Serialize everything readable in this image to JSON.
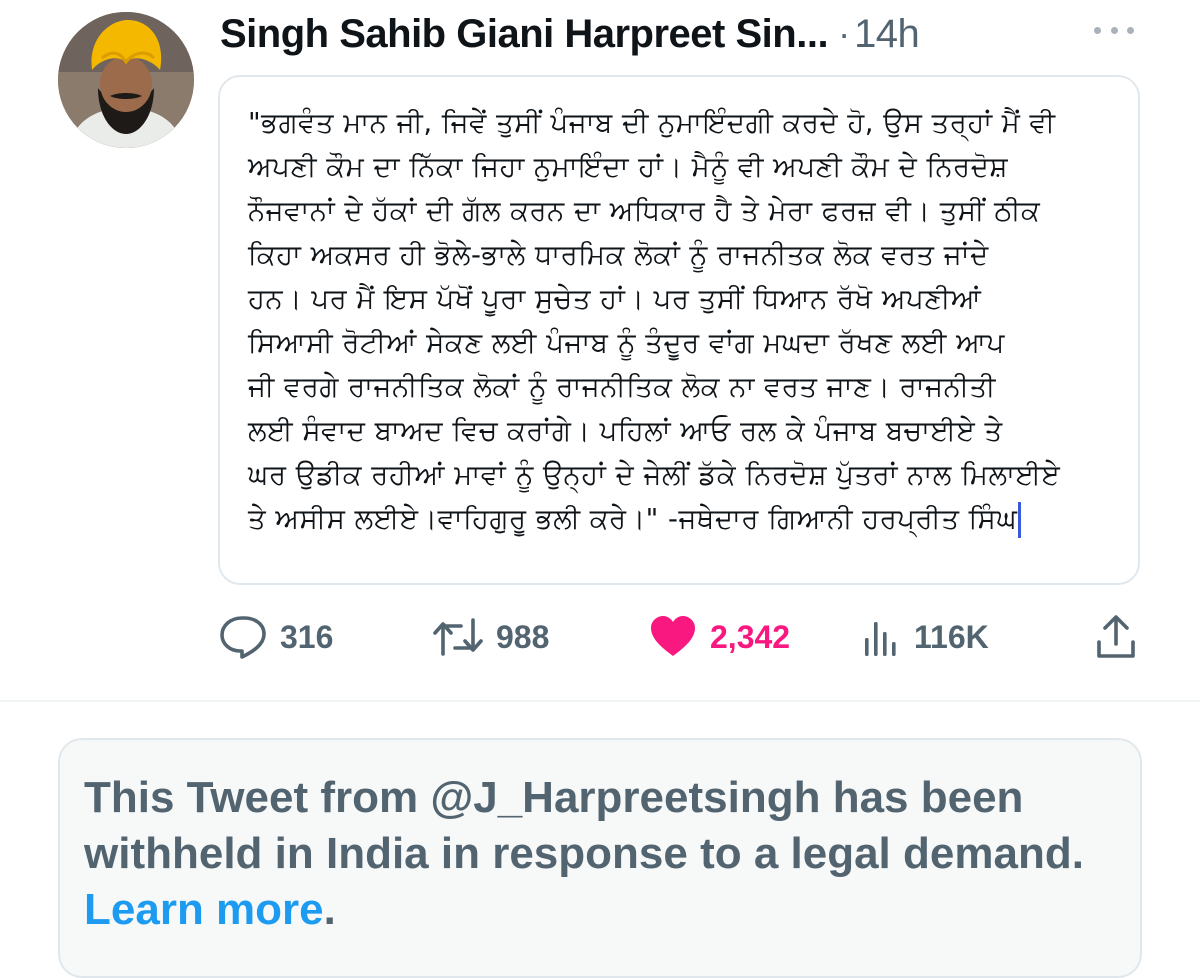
{
  "tweet": {
    "author_name": "Singh Sahib Giani Harpreet Sin...",
    "separator": "·",
    "time": "14h",
    "lines": [
      "\"ਭਗਵੰਤ ਮਾਨ ਜੀ, ਜਿਵੇਂ ਤੁਸੀਂ ਪੰਜਾਬ ਦੀ ਨੁਮਾਇੰਦਗੀ ਕਰਦੇ ਹੋ, ਉਸ ਤਰ੍ਹਾਂ ਮੈਂ ਵੀ",
      "ਅਪਣੀ ਕੌਮ ਦਾ ਨਿੱਕਾ ਜਿਹਾ ਨੁਮਾਇੰਦਾ ਹਾਂ। ਮੈਨੂੰ ਵੀ ਅਪਣੀ ਕੌਮ ਦੇ ਨਿਰਦੋਸ਼",
      "ਨੌਜਵਾਨਾਂ ਦੇ ਹੱਕਾਂ ਦੀ ਗੱਲ ਕਰਨ ਦਾ ਅਧਿਕਾਰ ਹੈ ਤੇ ਮੇਰਾ ਫਰਜ਼ ਵੀ। ਤੁਸੀਂ ਠੀਕ",
      "ਕਿਹਾ ਅਕਸਰ ਹੀ ਭੋਲੇ-ਭਾਲੇ ਧਾਰਮਿਕ ਲੋਕਾਂ ਨੂੰ ਰਾਜਨੀਤਕ ਲੋਕ ਵਰਤ ਜਾਂਦੇ",
      "ਹਨ। ਪਰ ਮੈਂ ਇਸ ਪੱਖੋਂ ਪੂਰਾ ਸੁਚੇਤ ਹਾਂ। ਪਰ ਤੁਸੀਂ ਧਿਆਨ ਰੱਖੋ ਅਪਣੀਆਂ",
      "ਸਿਆਸੀ ਰੋਟੀਆਂ ਸੇਕਣ ਲਈ ਪੰਜਾਬ ਨੂੰ ਤੰਦੂਰ ਵਾਂਗ ਮਘਦਾ ਰੱਖਣ ਲਈ ਆਪ",
      "ਜੀ ਵਰਗੇ ਰਾਜਨੀਤਿਕ ਲੋਕਾਂ ਨੂੰ ਰਾਜਨੀਤਿਕ ਲੋਕ ਨਾ ਵਰਤ ਜਾਣ। ਰਾਜਨੀਤੀ",
      "ਲਈ ਸੰਵਾਦ ਬਾਅਦ ਵਿਚ ਕਰਾਂਗੇ। ਪਹਿਲਾਂ ਆਓ ਰਲ ਕੇ ਪੰਜਾਬ ਬਚਾਈਏ ਤੇ",
      "ਘਰ ਉਡੀਕ ਰਹੀਆਂ ਮਾਵਾਂ ਨੂੰ ਉਨ੍ਹਾਂ ਦੇ ਜੇਲੀਂ ਡੱਕੇ ਨਿਰਦੋਸ਼ ਪੁੱਤਰਾਂ ਨਾਲ ਮਿਲਾਈਏ",
      "ਤੇ ਅਸੀਸ ਲਈਏ।ਵਾਹਿਗੁਰੂ ਭਲੀ ਕਰੇ।\"  -ਜਥੇਦਾਰ ਗਿਆਨੀ ਹਰਪ੍ਰੀਤ ਸਿੰਘ"
    ]
  },
  "actions": {
    "replies": "316",
    "retweets": "988",
    "likes": "2,342",
    "views": "116K"
  },
  "notice": {
    "text": "This Tweet from @J_Harpreetsingh has been withheld in India in response to a legal demand.",
    "link": "Learn more",
    "trailing": "."
  },
  "colors": {
    "like_pink": "#f91880",
    "link_blue": "#1d9bf0",
    "muted_gray": "#536471"
  },
  "icons": [
    "comment-icon",
    "retweet-icon",
    "heart-icon",
    "views-icon",
    "share-icon",
    "more-icon"
  ]
}
